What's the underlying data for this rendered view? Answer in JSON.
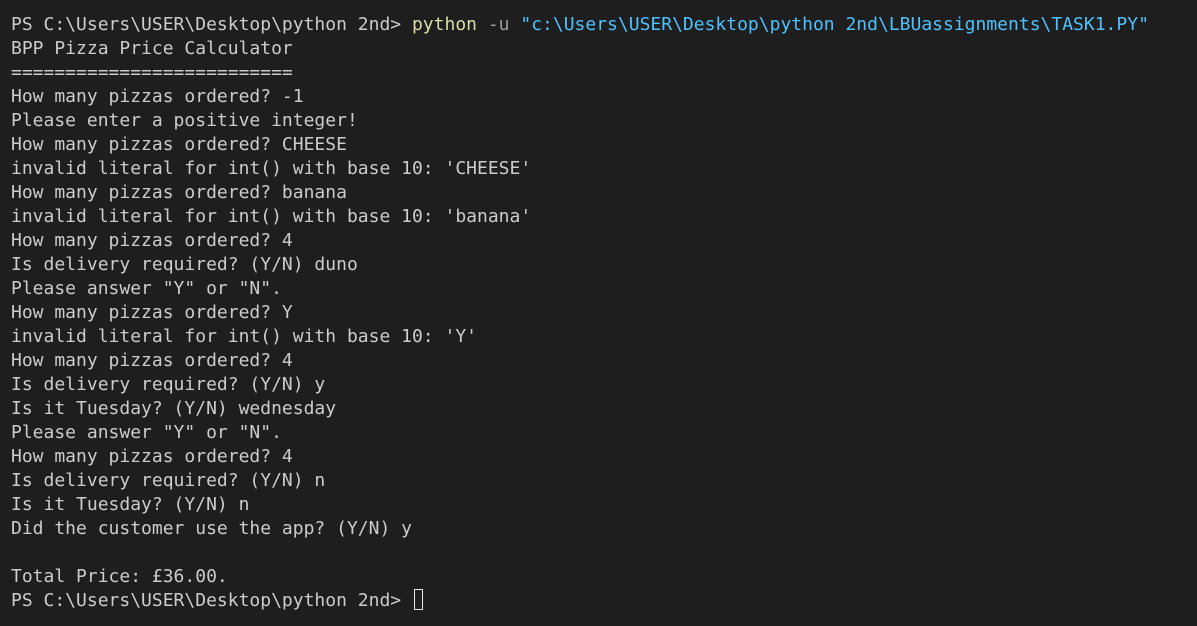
{
  "terminal": {
    "first_prompt": "PS C:\\Users\\USER\\Desktop\\python 2nd> ",
    "command": "python",
    "flag": " -u ",
    "script_path": "\"c:\\Users\\USER\\Desktop\\python 2nd\\LBUassignments\\TASK1.PY\"",
    "output_lines": [
      "BPP Pizza Price Calculator",
      "==========================",
      "How many pizzas ordered? -1",
      "Please enter a positive integer!",
      "How many pizzas ordered? CHEESE",
      "invalid literal for int() with base 10: 'CHEESE'",
      "How many pizzas ordered? banana",
      "invalid literal for int() with base 10: 'banana'",
      "How many pizzas ordered? 4",
      "Is delivery required? (Y/N) duno",
      "Please answer \"Y\" or \"N\".",
      "How many pizzas ordered? Y",
      "invalid literal for int() with base 10: 'Y'",
      "How many pizzas ordered? 4",
      "Is delivery required? (Y/N) y",
      "Is it Tuesday? (Y/N) wednesday",
      "Please answer \"Y\" or \"N\".",
      "How many pizzas ordered? 4",
      "Is delivery required? (Y/N) n",
      "Is it Tuesday? (Y/N) n",
      "Did the customer use the app? (Y/N) y",
      "",
      "Total Price: £36.00."
    ],
    "final_prompt": "PS C:\\Users\\USER\\Desktop\\python 2nd> "
  },
  "colors": {
    "background": "#1e1e1e",
    "text": "#cccccc",
    "command": "#dcdcaa",
    "flag": "#9d9d9d",
    "string": "#4fc1ff"
  }
}
